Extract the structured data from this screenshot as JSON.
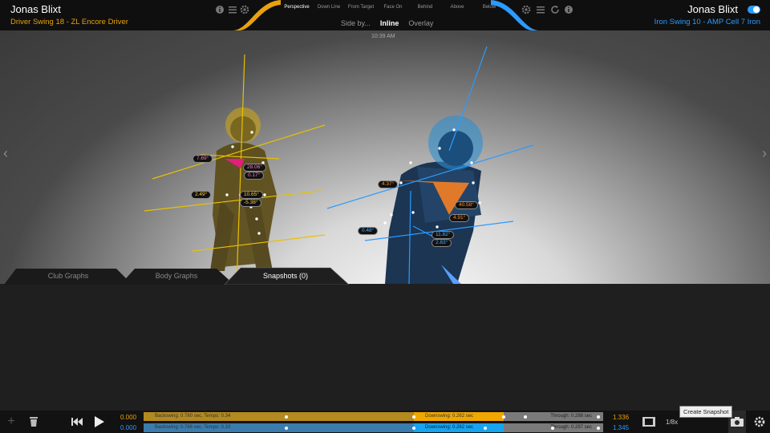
{
  "header": {
    "left_player": "Jonas Blixt",
    "left_swing": "Driver Swing 18 - ZL Encore Driver",
    "right_player": "Jonas Blixt",
    "right_swing": "Iron Swing 10 - AMP Cell 7 Iron",
    "views": [
      "Perspective",
      "Down Line",
      "From Target",
      "Face On",
      "Behind",
      "Above",
      "Below"
    ],
    "active_view": "Perspective",
    "modes": [
      "Side by...",
      "Inline",
      "Overlay"
    ],
    "active_mode": "Inline",
    "time": "10:39 AM"
  },
  "angles": {
    "gold": [
      "7.69°",
      "28.06°",
      "0.17°",
      "2.49°",
      "10.65°",
      "-5.38°"
    ],
    "blue": [
      "4.37°",
      "40.58°",
      "4.91°",
      "0.48°",
      "11.82°",
      "2.83°"
    ]
  },
  "tabs": [
    "Club Graphs",
    "Body Graphs",
    "Snapshots (0)"
  ],
  "timeline": {
    "orange": {
      "start": "0.000",
      "end": "1.336",
      "backswing": "Backswing: 0.780 sec, Tempo: 0.34",
      "downswing": "Downswing: 0.262 sec",
      "through": "Through: 0.288 sec"
    },
    "blue": {
      "start": "0.000",
      "end": "1.345",
      "backswing": "Backswing: 0.786 sec, Tempo: 0.33",
      "downswing": "Downswing: 0.262 sec",
      "through": "Through: 0.297 sec"
    },
    "speed": "1/8x",
    "tooltip": "Create Snapshot"
  },
  "colors": {
    "gold": "#e8a20c",
    "blue": "#2a9bff"
  }
}
